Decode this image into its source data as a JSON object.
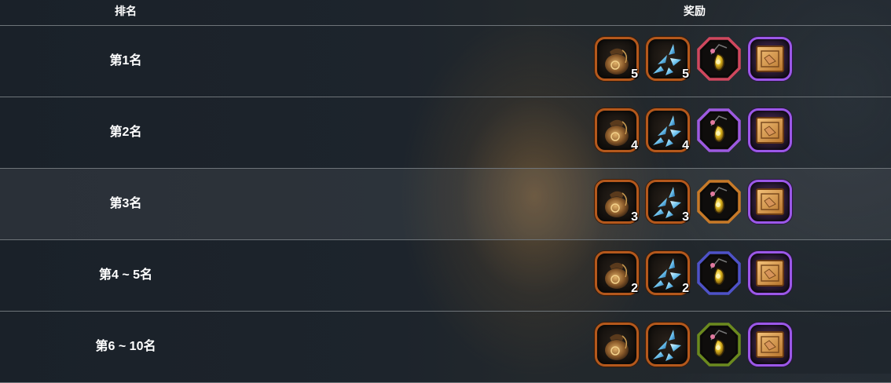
{
  "header": {
    "rank_label": "排名",
    "reward_label": "奖励"
  },
  "rows": [
    {
      "rank": "第1名",
      "bag_count": "5",
      "shard_count": "5",
      "amulet_frame": "#d0485e"
    },
    {
      "rank": "第2名",
      "bag_count": "4",
      "shard_count": "4",
      "amulet_frame": "#9d5ae0"
    },
    {
      "rank": "第3名",
      "bag_count": "3",
      "shard_count": "3",
      "amulet_frame": "#c87a28"
    },
    {
      "rank": "第4 ~ 5名",
      "bag_count": "2",
      "shard_count": "2",
      "amulet_frame": "#4e52c8"
    },
    {
      "rank": "第6 ~ 10名",
      "bag_count": "",
      "shard_count": "",
      "amulet_frame": "#6b8a1e"
    }
  ],
  "icons": [
    "gold-bag-icon",
    "crystal-shard-icon",
    "amulet-icon",
    "scroll-icon"
  ],
  "colors": {
    "bronze_frame": "#b4581c",
    "purple_frame": "#9b58e8",
    "divider": "#6e7479"
  }
}
